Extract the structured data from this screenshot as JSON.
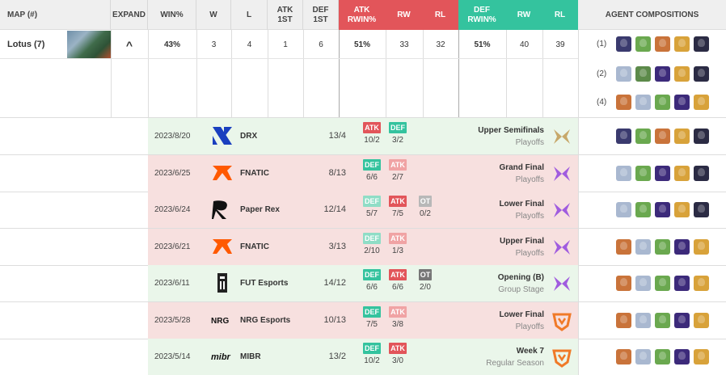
{
  "header": {
    "map": "MAP (#)",
    "expand": "EXPAND",
    "winpct": "WIN%",
    "w": "W",
    "l": "L",
    "atk1st": [
      "ATK",
      "1ST"
    ],
    "def1st": [
      "DEF",
      "1ST"
    ],
    "atkrwin": [
      "ATK",
      "RWIN%"
    ],
    "atkrw": "RW",
    "atkrl": "RL",
    "defrwin": [
      "DEF",
      "RWIN%"
    ],
    "defrw": "RW",
    "defrl": "RL",
    "agents": "AGENT COMPOSITIONS"
  },
  "summary": {
    "map": "Lotus (7)",
    "expand_icon": "^",
    "winpct": "43%",
    "w": "3",
    "l": "4",
    "atk1st": "1",
    "def1st": "6",
    "atkrwin": "51%",
    "atkrw": "33",
    "atkrl": "32",
    "defrwin": "51%",
    "defrw": "40",
    "defrl": "39",
    "compositions": [
      {
        "count": "(1)",
        "agents": [
          "harbor",
          "gekko",
          "raze",
          "killjoy",
          "omen"
        ]
      },
      {
        "count": "(2)",
        "agents": [
          "jett",
          "skye",
          "astra",
          "killjoy",
          "omen"
        ]
      },
      {
        "count": "(4)",
        "agents": [
          "raze",
          "jett",
          "gekko",
          "astra",
          "killjoy"
        ]
      }
    ]
  },
  "matches": [
    {
      "date": "2023/8/20",
      "team": "DRX",
      "logo": "drx-logo",
      "score": "13/4",
      "result": "win",
      "sides": [
        {
          "label": "ATK",
          "type": "atk",
          "dim": false,
          "score": "10/2"
        },
        {
          "label": "DEF",
          "type": "def",
          "dim": false,
          "score": "3/2"
        }
      ],
      "event": "Upper Semifinals",
      "stage": "Playoffs",
      "event_logo": "champions-logo",
      "agents": [
        "harbor",
        "gekko",
        "raze",
        "killjoy",
        "omen"
      ]
    },
    {
      "date": "2023/6/25",
      "team": "FNATIC",
      "logo": "fnatic-logo",
      "score": "8/13",
      "result": "loss",
      "sides": [
        {
          "label": "DEF",
          "type": "def",
          "dim": false,
          "score": "6/6"
        },
        {
          "label": "ATK",
          "type": "atk",
          "dim": true,
          "score": "2/7"
        }
      ],
      "event": "Grand Final",
      "stage": "Playoffs",
      "event_logo": "masters-logo",
      "agents": [
        "jett",
        "gekko",
        "astra",
        "killjoy",
        "omen"
      ]
    },
    {
      "date": "2023/6/24",
      "team": "Paper Rex",
      "logo": "paper-rex-logo",
      "score": "12/14",
      "result": "loss",
      "sides": [
        {
          "label": "DEF",
          "type": "def",
          "dim": true,
          "score": "5/7"
        },
        {
          "label": "ATK",
          "type": "atk",
          "dim": false,
          "score": "7/5"
        },
        {
          "label": "OT",
          "type": "ot",
          "dim": true,
          "score": "0/2"
        }
      ],
      "event": "Lower Final",
      "stage": "Playoffs",
      "event_logo": "masters-logo",
      "agents": [
        "jett",
        "gekko",
        "astra",
        "killjoy",
        "omen"
      ]
    },
    {
      "date": "2023/6/21",
      "team": "FNATIC",
      "logo": "fnatic-logo",
      "score": "3/13",
      "result": "loss",
      "sides": [
        {
          "label": "DEF",
          "type": "def",
          "dim": true,
          "score": "2/10"
        },
        {
          "label": "ATK",
          "type": "atk",
          "dim": true,
          "score": "1/3"
        }
      ],
      "event": "Upper Final",
      "stage": "Playoffs",
      "event_logo": "masters-logo",
      "agents": [
        "raze",
        "jett",
        "gekko",
        "astra",
        "killjoy"
      ]
    },
    {
      "date": "2023/6/11",
      "team": "FUT Esports",
      "logo": "fut-logo",
      "score": "14/12",
      "result": "win",
      "sides": [
        {
          "label": "DEF",
          "type": "def",
          "dim": false,
          "score": "6/6"
        },
        {
          "label": "ATK",
          "type": "atk",
          "dim": false,
          "score": "6/6"
        },
        {
          "label": "OT",
          "type": "ot",
          "dim": false,
          "score": "2/0"
        }
      ],
      "event": "Opening (B)",
      "stage": "Group Stage",
      "event_logo": "masters-logo",
      "agents": [
        "raze",
        "jett",
        "gekko",
        "astra",
        "killjoy"
      ]
    },
    {
      "date": "2023/5/28",
      "team": "NRG Esports",
      "logo": "nrg-logo",
      "score": "10/13",
      "result": "loss",
      "sides": [
        {
          "label": "DEF",
          "type": "def",
          "dim": false,
          "score": "7/5"
        },
        {
          "label": "ATK",
          "type": "atk",
          "dim": true,
          "score": "3/8"
        }
      ],
      "event": "Lower Final",
      "stage": "Playoffs",
      "event_logo": "vct-americas-logo",
      "agents": [
        "raze",
        "jett",
        "gekko",
        "astra",
        "killjoy"
      ]
    },
    {
      "date": "2023/5/14",
      "team": "MIBR",
      "logo": "mibr-logo",
      "score": "13/2",
      "result": "win",
      "sides": [
        {
          "label": "DEF",
          "type": "def",
          "dim": false,
          "score": "10/2"
        },
        {
          "label": "ATK",
          "type": "atk",
          "dim": false,
          "score": "3/0"
        }
      ],
      "event": "Week 7",
      "stage": "Regular Season",
      "event_logo": "vct-americas-logo",
      "agents": [
        "raze",
        "jett",
        "gekko",
        "astra",
        "killjoy"
      ]
    }
  ],
  "agent_colors": {
    "harbor": "#3a3a6e",
    "gekko": "#6aa84f",
    "raze": "#c9733a",
    "killjoy": "#d8a23a",
    "omen": "#2b2b44",
    "jett": "#a9b8d0",
    "skye": "#5c8a4a",
    "astra": "#3c2a7a"
  }
}
